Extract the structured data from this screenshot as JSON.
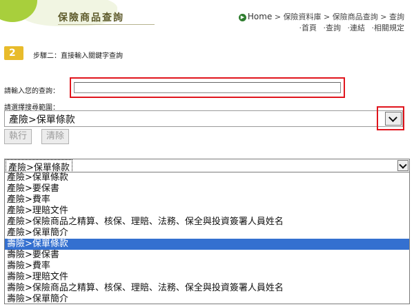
{
  "header": {
    "title": "保險商品查詢",
    "breadcrumb": [
      "Home",
      "保險資料庫",
      "保險商品查詢",
      "查詢"
    ],
    "breadcrumb_sep": " > ",
    "sub_links": [
      "‧首頁",
      "‧查詢",
      "‧連結",
      "‧相關規定"
    ]
  },
  "step": {
    "number": "2",
    "text": "步驟二：直接輸入關鍵字查詢"
  },
  "query": {
    "label": "請輸入您的查詢：",
    "value": "",
    "placeholder": ""
  },
  "range": {
    "label": "請選擇搜尋範圍：",
    "selected": "產險>保單條款"
  },
  "buttons": {
    "execute": "執行",
    "clear": "清除"
  },
  "expanded": {
    "selected": "產險>保單條款",
    "options": [
      "產險>保單條款",
      "產險>要保書",
      "產險>費率",
      "產險>理賠文件",
      "產險>保險商品之精算、核保、理賠、法務、保全與投資簽署人員姓名",
      "產險>保單簡介",
      "壽險>保單條款",
      "壽險>要保書",
      "壽險>費率",
      "壽險>理賠文件",
      "壽險>保險商品之精算、核保、理賠、法務、保全與投資簽署人員姓名",
      "壽險>保單簡介"
    ],
    "highlighted_index": 6
  },
  "colors": {
    "accent_green": "#a8cf3c",
    "step_badge": "#e8bb2b",
    "highlight_box": "#e0141c",
    "selection": "#3470d0"
  },
  "icons": {
    "logo": "arrow-logo-icon",
    "home": "home-arrow-icon",
    "dropdown": "chevron-down-icon"
  }
}
